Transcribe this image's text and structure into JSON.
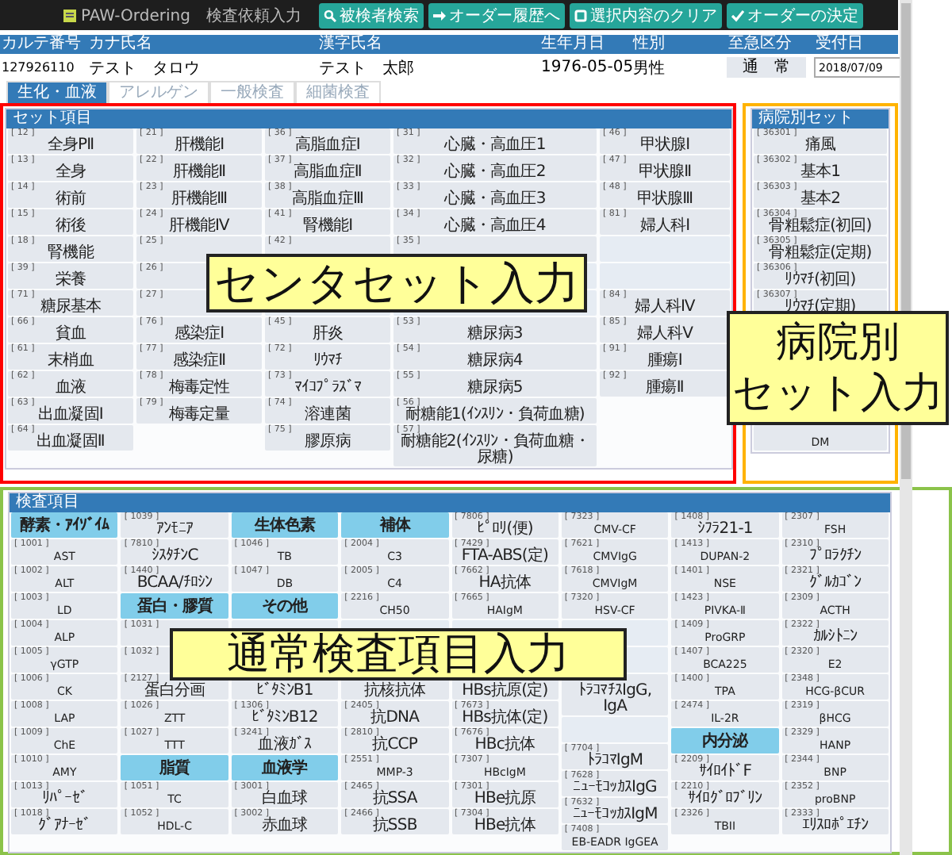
{
  "app": {
    "title": "PAW-Ordering　検査依頼入力"
  },
  "toolbar": [
    {
      "kind": "search",
      "label": "被検者検索"
    },
    {
      "kind": "arrow",
      "label": "オーダー履歴へ"
    },
    {
      "kind": "square",
      "label": "選択内容のクリア"
    },
    {
      "kind": "check",
      "label": "オーダーの決定"
    }
  ],
  "patient": {
    "columns": [
      "カルテ番号",
      "カナ氏名",
      "漢字氏名",
      "生年月日",
      "性別",
      "至急区分",
      "受付日"
    ],
    "chart_no": "127926110",
    "kana_name": "テスト　タロウ",
    "kanji_name": "テスト　太郎",
    "birth_date": "1976-05-05",
    "sex": "男性",
    "urgency": "通　常",
    "reception_date": "2018/07/09"
  },
  "tabs": [
    {
      "label": "生化・血液",
      "selected": true
    },
    {
      "label": "アレルゲン",
      "selected": false
    },
    {
      "label": "一般検査",
      "selected": false
    },
    {
      "label": "細菌検査",
      "selected": false
    }
  ],
  "center_sets": {
    "title": "セット項目",
    "columns": [
      [
        {
          "kind": "item",
          "code": "[ 12 ]",
          "name": "全身PⅡ"
        },
        {
          "kind": "item",
          "code": "[ 13 ]",
          "name": "全身"
        },
        {
          "kind": "item",
          "code": "[ 14 ]",
          "name": "術前"
        },
        {
          "kind": "item",
          "code": "[ 15 ]",
          "name": "術後"
        },
        {
          "kind": "item",
          "code": "[ 18 ]",
          "name": "腎機能"
        },
        {
          "kind": "item",
          "code": "[ 39 ]",
          "name": "栄養"
        },
        {
          "kind": "item",
          "code": "[ 71 ]",
          "name": "糖尿基本"
        },
        {
          "kind": "item",
          "code": "[ 66 ]",
          "name": "貧血"
        },
        {
          "kind": "item",
          "code": "[ 61 ]",
          "name": "末梢血"
        },
        {
          "kind": "item",
          "code": "[ 62 ]",
          "name": "血液"
        },
        {
          "kind": "item",
          "code": "[ 63 ]",
          "name": "出血凝固Ⅰ"
        },
        {
          "kind": "item",
          "code": "[ 64 ]",
          "name": "出血凝固Ⅱ"
        }
      ],
      [
        {
          "kind": "item",
          "code": "[ 21 ]",
          "name": "肝機能Ⅰ"
        },
        {
          "kind": "item",
          "code": "[ 22 ]",
          "name": "肝機能Ⅱ"
        },
        {
          "kind": "item",
          "code": "[ 23 ]",
          "name": "肝機能Ⅲ"
        },
        {
          "kind": "item",
          "code": "[ 24 ]",
          "name": "肝機能Ⅳ"
        },
        {
          "kind": "item",
          "code": "[ 25 ]"
        },
        {
          "kind": "item",
          "code": "[ 26 ]"
        },
        {
          "kind": "item",
          "code": "[ 27 ]"
        },
        {
          "kind": "item",
          "code": "[ 76 ]",
          "name": "感染症Ⅰ"
        },
        {
          "kind": "item",
          "code": "[ 77 ]",
          "name": "感染症Ⅱ"
        },
        {
          "kind": "item",
          "code": "[ 78 ]",
          "name": "梅毒定性"
        },
        {
          "kind": "item",
          "code": "[ 79 ]",
          "name": "梅毒定量"
        }
      ],
      [
        {
          "kind": "item",
          "code": "[ 36 ]",
          "name": "高脂血症Ⅰ"
        },
        {
          "kind": "item",
          "code": "[ 37 ]",
          "name": "高脂血症Ⅱ"
        },
        {
          "kind": "item",
          "code": "[ 38 ]",
          "name": "高脂血症Ⅲ"
        },
        {
          "kind": "item",
          "code": "[ 41 ]",
          "name": "腎機能Ⅰ"
        },
        {
          "kind": "item",
          "code": "[ 42 ]"
        },
        {
          "kind": "hidden"
        },
        {
          "kind": "blank"
        },
        {
          "kind": "item",
          "code": "[ 45 ]",
          "name": "肝炎"
        },
        {
          "kind": "item",
          "code": "[ 72 ]",
          "name": "ﾘｳﾏﾁ"
        },
        {
          "kind": "item",
          "code": "[ 73 ]",
          "name": "ﾏｲｺﾌﾟﾗｽﾞﾏ"
        },
        {
          "kind": "item",
          "code": "[ 74 ]",
          "name": "溶連菌"
        },
        {
          "kind": "item",
          "code": "[ 75 ]",
          "name": "膠原病"
        }
      ],
      [
        {
          "kind": "item",
          "code": "[ 31 ]",
          "name": "心臓・高血圧1"
        },
        {
          "kind": "item",
          "code": "[ 32 ]",
          "name": "心臓・高血圧2"
        },
        {
          "kind": "item",
          "code": "[ 33 ]",
          "name": "心臓・高血圧3"
        },
        {
          "kind": "item",
          "code": "[ 34 ]",
          "name": "心臓・高血圧4"
        },
        {
          "kind": "item",
          "code": "[ 35 ]"
        },
        {
          "kind": "blank"
        },
        {
          "kind": "blank"
        },
        {
          "kind": "item",
          "code": "[ 53 ]",
          "name": "糖尿病3"
        },
        {
          "kind": "item",
          "code": "[ 54 ]",
          "name": "糖尿病4"
        },
        {
          "kind": "item",
          "code": "[ 55 ]",
          "name": "糖尿病5"
        },
        {
          "kind": "item",
          "code": "[ 56 ]",
          "name": "耐糖能1(ｲﾝｽﾘﾝ・負荷血糖)"
        },
        {
          "kind": "item",
          "code": "[ 57 ]",
          "name": "耐糖能2(ｲﾝｽﾘﾝ・負荷血糖・尿糖)"
        }
      ],
      [
        {
          "kind": "item",
          "code": "[ 46 ]",
          "name": "甲状腺Ⅰ"
        },
        {
          "kind": "item",
          "code": "[ 47 ]",
          "name": "甲状腺Ⅱ"
        },
        {
          "kind": "item",
          "code": "[ 48 ]",
          "name": "甲状腺Ⅲ"
        },
        {
          "kind": "item",
          "code": "[ 81 ]",
          "name": "婦人科Ⅰ"
        },
        {
          "kind": "blank"
        },
        {
          "kind": "blank"
        },
        {
          "kind": "item",
          "code": "[ 84 ]",
          "name": "婦人科Ⅳ"
        },
        {
          "kind": "item",
          "code": "[ 85 ]",
          "name": "婦人科Ⅴ"
        },
        {
          "kind": "item",
          "code": "[ 91 ]",
          "name": "腫瘍Ⅰ"
        },
        {
          "kind": "item",
          "code": "[ 92 ]",
          "name": "腫瘍Ⅱ"
        }
      ]
    ]
  },
  "hospital_sets": {
    "title": "病院別セット",
    "items": [
      {
        "kind": "item",
        "code": "[ 36301 ]",
        "name": "痛風"
      },
      {
        "kind": "item",
        "code": "[ 36302 ]",
        "name": "基本1"
      },
      {
        "kind": "item",
        "code": "[ 36303 ]",
        "name": "基本2"
      },
      {
        "kind": "item",
        "code": "[ 36304 ]",
        "name": "骨粗鬆症(初回)"
      },
      {
        "kind": "item",
        "code": "[ 36305 ]",
        "name": "骨粗鬆症(定期)"
      },
      {
        "kind": "item",
        "code": "[ 36306 ]",
        "name": "ﾘｳﾏﾁ(初回)"
      },
      {
        "kind": "item",
        "code": "[ 36307 ]",
        "name": "ﾘｳﾏﾁ(定期)"
      },
      {
        "kind": "hidden"
      },
      {
        "kind": "hidden"
      },
      {
        "kind": "hidden"
      },
      {
        "kind": "blank"
      },
      {
        "kind": "item",
        "name": "DM"
      }
    ]
  },
  "tests": {
    "title": "検査項目",
    "columns": [
      [
        {
          "kind": "header",
          "label": "酵素・ｱｲｿﾞｲﾑ"
        },
        {
          "kind": "item",
          "code": "[ 1001 ]",
          "name": "AST"
        },
        {
          "kind": "item",
          "code": "[ 1002 ]",
          "name": "ALT"
        },
        {
          "kind": "item",
          "code": "[ 1003 ]",
          "name": "LD"
        },
        {
          "kind": "item",
          "code": "[ 1004 ]",
          "name": "ALP"
        },
        {
          "kind": "item",
          "code": "[ 1005 ]",
          "name": "γGTP"
        },
        {
          "kind": "item",
          "code": "[ 1006 ]",
          "name": "CK"
        },
        {
          "kind": "item",
          "code": "[ 1008 ]",
          "name": "LAP"
        },
        {
          "kind": "item",
          "code": "[ 1009 ]",
          "name": "ChE"
        },
        {
          "kind": "item",
          "code": "[ 1010 ]",
          "name": "AMY"
        },
        {
          "kind": "item",
          "code": "[ 1013 ]",
          "name": "ﾘﾊﾟｰｾﾞ"
        },
        {
          "kind": "item",
          "code": "[ 1018 ]",
          "name": "ｸﾞｱﾅｰｾﾞ"
        }
      ],
      [
        {
          "kind": "item",
          "code": "[ 1039 ]",
          "name": "ｱﾝﾓﾆｱ"
        },
        {
          "kind": "item",
          "code": "[ 7810 ]",
          "name": "ｼｽﾀﾁﾝC"
        },
        {
          "kind": "item",
          "code": "[ 1440 ]",
          "name": "BCAA/ﾁﾛｼﾝ"
        },
        {
          "kind": "header",
          "label": "蛋白・膠質"
        },
        {
          "kind": "item",
          "code": "[ 1031 ]"
        },
        {
          "kind": "item",
          "code": "[ 1032 ]"
        },
        {
          "kind": "item",
          "code": "[ 2127 ]",
          "name": "蛋白分画"
        },
        {
          "kind": "item",
          "code": "[ 1026 ]",
          "name": "ZTT"
        },
        {
          "kind": "item",
          "code": "[ 1027 ]",
          "name": "TTT"
        },
        {
          "kind": "header",
          "label": "脂質"
        },
        {
          "kind": "item",
          "code": "[ 1051 ]",
          "name": "TC"
        },
        {
          "kind": "item",
          "code": "[ 1052 ]",
          "name": "HDL-C"
        }
      ],
      [
        {
          "kind": "header",
          "label": "生体色素"
        },
        {
          "kind": "item",
          "code": "[ 1046 ]",
          "name": "TB"
        },
        {
          "kind": "item",
          "code": "[ 1047 ]",
          "name": "DB"
        },
        {
          "kind": "header",
          "label": "その他"
        },
        {
          "kind": "blank"
        },
        {
          "kind": "blank"
        },
        {
          "kind": "item",
          "name": "ﾋﾞﾀﾐﾝB1"
        },
        {
          "kind": "item",
          "code": "[ 1306 ]",
          "name": "ﾋﾞﾀﾐﾝB12"
        },
        {
          "kind": "item",
          "code": "[ 3241 ]",
          "name": "血液ｶﾞｽ"
        },
        {
          "kind": "header",
          "label": "血液学"
        },
        {
          "kind": "item",
          "code": "[ 3001 ]",
          "name": "白血球"
        },
        {
          "kind": "item",
          "code": "[ 3002 ]",
          "name": "赤血球"
        }
      ],
      [
        {
          "kind": "header",
          "label": "補体"
        },
        {
          "kind": "item",
          "code": "[ 2004 ]",
          "name": "C3"
        },
        {
          "kind": "item",
          "code": "[ 2005 ]",
          "name": "C4"
        },
        {
          "kind": "item",
          "code": "[ 2216 ]",
          "name": "CH50"
        },
        {
          "kind": "blank"
        },
        {
          "kind": "blank"
        },
        {
          "kind": "item",
          "name": "抗核抗体"
        },
        {
          "kind": "item",
          "code": "[ 2405 ]",
          "name": "抗DNA"
        },
        {
          "kind": "item",
          "code": "[ 2810 ]",
          "name": "抗CCP"
        },
        {
          "kind": "item",
          "code": "[ 2551 ]",
          "name": "MMP-3"
        },
        {
          "kind": "item",
          "code": "[ 2465 ]",
          "name": "抗SSA"
        },
        {
          "kind": "item",
          "code": "[ 2466 ]",
          "name": "抗SSB"
        }
      ],
      [
        {
          "kind": "item",
          "code": "[ 7806 ]",
          "name": "ﾋﾟﾛﾘ(便)"
        },
        {
          "kind": "item",
          "code": "[ 7429 ]",
          "name": "FTA-ABS(定)"
        },
        {
          "kind": "item",
          "code": "[ 7662 ]",
          "name": "HA抗体"
        },
        {
          "kind": "item",
          "code": "[ 7665 ]",
          "name": "HAIgM"
        },
        {
          "kind": "blank"
        },
        {
          "kind": "blank"
        },
        {
          "kind": "item",
          "name": "HBs抗原(定)"
        },
        {
          "kind": "item",
          "code": "[ 7673 ]",
          "name": "HBs抗体(定)"
        },
        {
          "kind": "item",
          "code": "[ 7676 ]",
          "name": "HBc抗体"
        },
        {
          "kind": "item",
          "code": "[ 7307 ]",
          "name": "HBcIgM"
        },
        {
          "kind": "item",
          "code": "[ 7301 ]",
          "name": "HBe抗原"
        },
        {
          "kind": "item",
          "code": "[ 7304 ]",
          "name": "HBe抗体"
        }
      ],
      [
        {
          "kind": "item",
          "code": "[ 7323 ]",
          "name": "CMV-CF"
        },
        {
          "kind": "item",
          "code": "[ 7621 ]",
          "name": "CMVIgG"
        },
        {
          "kind": "item",
          "code": "[ 7618 ]",
          "name": "CMVIgM"
        },
        {
          "kind": "item",
          "code": "[ 7320 ]",
          "name": "HSV-CF"
        },
        {
          "kind": "blank"
        },
        {
          "kind": "blank"
        },
        {
          "kind": "item",
          "name": "ﾄﾗｺﾏﾁｽIgG, IgA"
        },
        {
          "kind": "blank"
        },
        {
          "kind": "item",
          "code": "[ 7704 ]",
          "name": "ﾄﾗｺﾏIgM"
        },
        {
          "kind": "item",
          "code": "[ 7628 ]",
          "name": "ﾆｭｰﾓｺｯｶｽIgG"
        },
        {
          "kind": "item",
          "code": "[ 7632 ]",
          "name": "ﾆｭｰﾓｺｯｶｽIgM"
        },
        {
          "kind": "item",
          "code": "[ 7408 ]",
          "name": "EB-EADR IgGEA"
        }
      ],
      [
        {
          "kind": "item",
          "code": "[ 1408 ]",
          "name": "ｼﾌﾗ21-1"
        },
        {
          "kind": "item",
          "code": "[ 1413 ]",
          "name": "DUPAN-2"
        },
        {
          "kind": "item",
          "code": "[ 1401 ]",
          "name": "NSE"
        },
        {
          "kind": "item",
          "code": "[ 1423 ]",
          "name": "PIVKA-Ⅱ"
        },
        {
          "kind": "item",
          "code": "[ 1409 ]",
          "name": "ProGRP"
        },
        {
          "kind": "item",
          "code": "[ 1407 ]",
          "name": "BCA225"
        },
        {
          "kind": "item",
          "code": "[ 1400 ]",
          "name": "TPA"
        },
        {
          "kind": "item",
          "code": "[ 2474 ]",
          "name": "IL-2R"
        },
        {
          "kind": "header",
          "label": "内分泌"
        },
        {
          "kind": "item",
          "code": "[ 2209 ]",
          "name": "ｻｲﾛｲﾄﾞF"
        },
        {
          "kind": "item",
          "code": "[ 2210 ]",
          "name": "ｻｲﾛｸﾞﾛﾌﾞﾘﾝ"
        },
        {
          "kind": "item",
          "code": "[ 2326 ]",
          "name": "TBII"
        }
      ],
      [
        {
          "kind": "item",
          "code": "[ 2307 ]",
          "name": "FSH"
        },
        {
          "kind": "item",
          "code": "[ 2310 ]",
          "name": "ﾌﾟﾛﾗｸﾁﾝ"
        },
        {
          "kind": "item",
          "code": "[ 2321 ]",
          "name": "ｸﾞﾙｶｺﾞﾝ"
        },
        {
          "kind": "item",
          "code": "[ 2309 ]",
          "name": "ACTH"
        },
        {
          "kind": "item",
          "code": "[ 2322 ]",
          "name": "ｶﾙｼﾄﾆﾝ"
        },
        {
          "kind": "item",
          "code": "[ 2320 ]",
          "name": "E2"
        },
        {
          "kind": "item",
          "code": "[ 2348 ]",
          "name": "HCG-βCUR"
        },
        {
          "kind": "item",
          "code": "[ 2319 ]",
          "name": "βHCG"
        },
        {
          "kind": "item",
          "code": "[ 2329 ]",
          "name": "HANP"
        },
        {
          "kind": "item",
          "code": "[ 2344 ]",
          "name": "BNP"
        },
        {
          "kind": "item",
          "code": "[ 2352 ]",
          "name": "proBNP"
        },
        {
          "kind": "item",
          "code": "[ 2333 ]",
          "name": "ｴﾘｽﾛﾎﾟｴﾁﾝ"
        }
      ]
    ]
  },
  "callouts": [
    "センタセット入力",
    "病院別",
    "セット入力",
    "通常検査項目入力"
  ]
}
